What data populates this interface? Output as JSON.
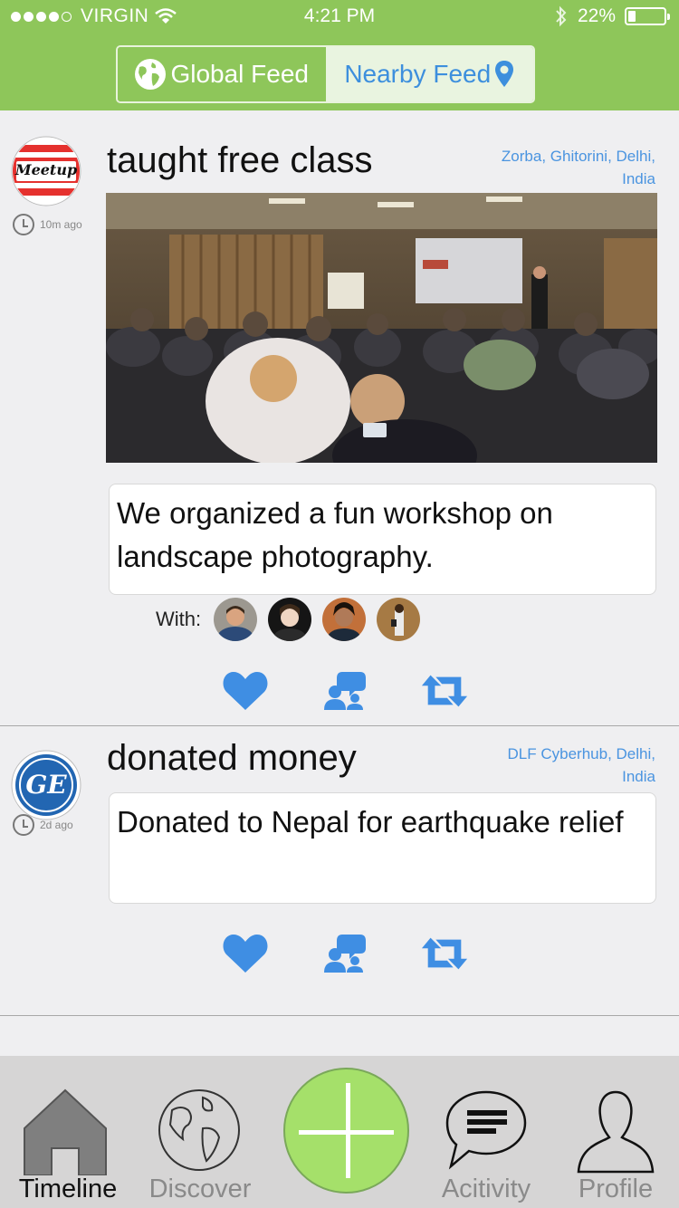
{
  "status_bar": {
    "carrier": "VIRGIN",
    "time": "4:21 PM",
    "battery": "22%",
    "battery_level": 0.22,
    "signal_bars_filled": 4,
    "icons": [
      "wifi-icon",
      "bluetooth-icon",
      "battery-icon"
    ]
  },
  "feed_toggle": {
    "global_label": "Global Feed",
    "nearby_label": "Nearby Feed",
    "selected": "Nearby Feed"
  },
  "posts": [
    {
      "org": "Meetup",
      "org_logo_text": "Meetup",
      "action": "taught free class",
      "time_ago": "10m ago",
      "location": "Zorba, Ghitorini, Delhi, India",
      "has_photo": true,
      "description": "We organized a fun workshop on landscape photography.",
      "with_label": "With:",
      "with_count": 4
    },
    {
      "org": "GE",
      "org_logo_text": "GE",
      "action": "donated money",
      "time_ago": "2d ago",
      "location": "DLF Cyberhub, Delhi, India",
      "has_photo": false,
      "description": "Donated to Nepal for earthquake relief"
    }
  ],
  "post_actions": [
    "heart-icon",
    "comment-icon",
    "repost-icon"
  ],
  "tabbar": {
    "items": [
      {
        "label": "Timeline",
        "icon": "home-icon",
        "active": true
      },
      {
        "label": "Discover",
        "icon": "globe-icon",
        "active": false
      },
      {
        "label": "Acitivity",
        "icon": "chat-bubble-icon",
        "active": false
      },
      {
        "label": "Profile",
        "icon": "person-icon",
        "active": false
      }
    ],
    "center_button_icon": "plus-icon"
  },
  "colors": {
    "header": "#8ec65a",
    "accent_blue": "#4a94e0",
    "plus_button": "#a5e06a",
    "tabbar_bg": "#d6d5d5"
  }
}
